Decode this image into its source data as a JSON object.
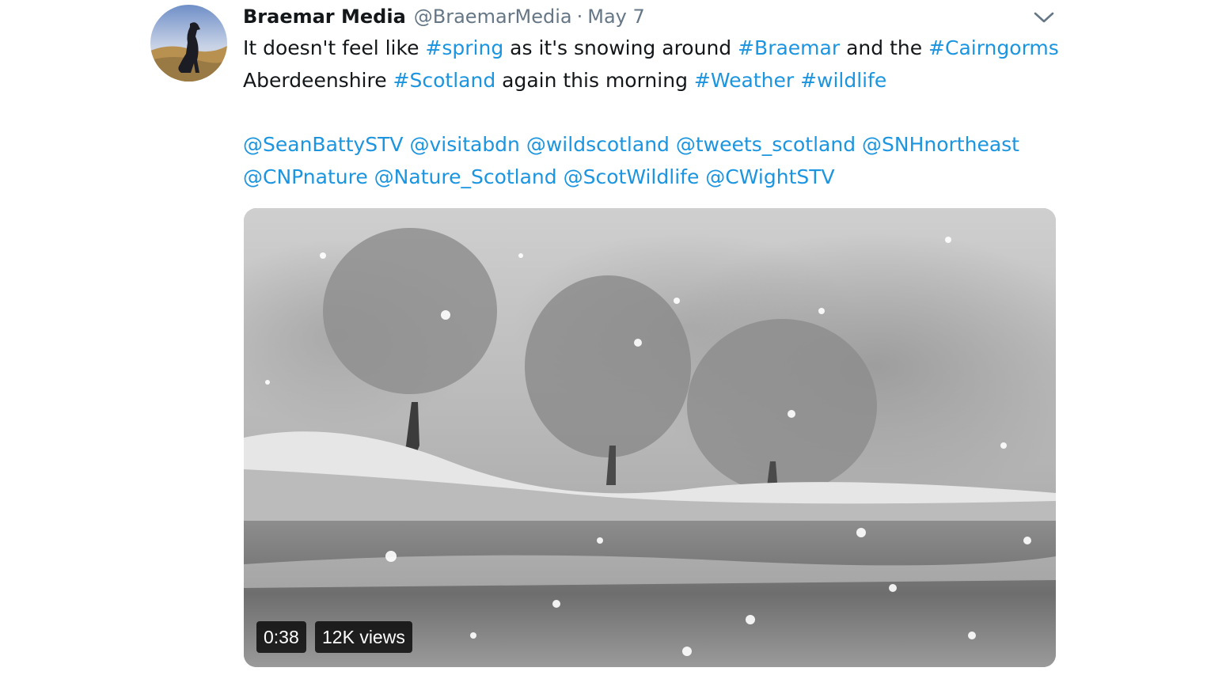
{
  "author": {
    "display_name": "Braemar Media",
    "handle": "@BraemarMedia",
    "separator": "·",
    "date": "May 7",
    "avatar_icon": "dog-silhouette-avatar"
  },
  "menu": {
    "icon": "chevron-down-icon"
  },
  "text": {
    "line1": {
      "t1": "It doesn't feel like ",
      "h1": "#spring",
      "t2": " as it's snowing around ",
      "h2": "#Braemar",
      "t3": " and the ",
      "h3": "#Cairngorms"
    },
    "line2": {
      "t1": "Aberdeenshire ",
      "h1": "#Scotland",
      "t2": " again this morning ",
      "h2": "#Weather",
      "t3": " ",
      "h3": "#wildlife"
    },
    "mentions_line1": [
      "@SeanBattySTV",
      "@visitabdn",
      "@wildscotland",
      "@tweets_scotland",
      "@SNHnortheast"
    ],
    "mentions_line2": [
      "@CNPnature",
      "@Nature_Scotland",
      "@ScotWildlife",
      "@CWightSTV"
    ]
  },
  "video": {
    "duration": "0:38",
    "views": "12K views"
  },
  "colors": {
    "link": "#1b95e0",
    "muted": "#657786",
    "text": "#14171a"
  }
}
